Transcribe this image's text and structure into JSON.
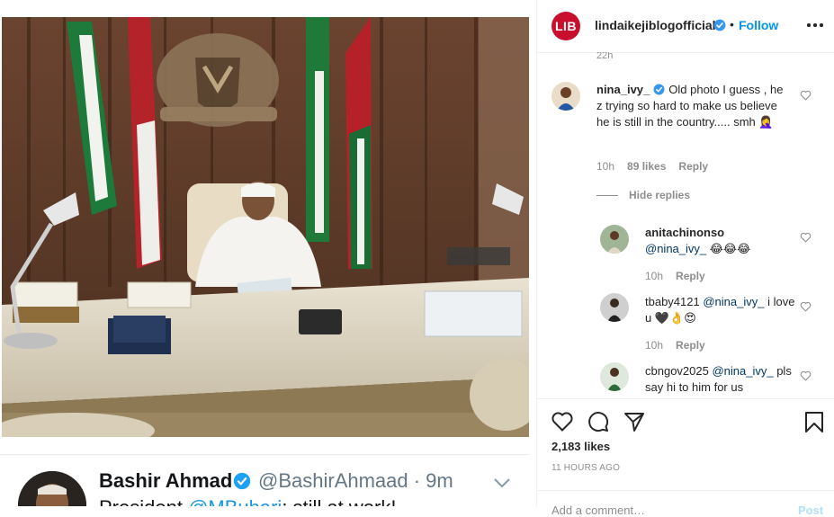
{
  "tweet": {
    "name": "Bashir Ahmad",
    "handle": "@BashirAhmaad · 9m",
    "text_prefix": "President ",
    "text_mention": "@MBuhari",
    "text_suffix": ": still at work!"
  },
  "header": {
    "logo": "LIB",
    "username": "lindaikejiblogofficial",
    "dot": "•",
    "follow": "Follow"
  },
  "comments": {
    "cut_time": "22h",
    "main": {
      "username": "nina_ivy_",
      "text": "Old photo I guess , he z trying so hard to make us believe he is still in the country..... smh 🤦‍♀️",
      "time": "10h",
      "likes": "89 likes",
      "reply": "Reply"
    },
    "hide_replies": "Hide replies",
    "replies": [
      {
        "username": "anitachinonso",
        "mention": "@nina_ivy_",
        "text": " 😂😂😂",
        "time": "10h",
        "reply": "Reply"
      },
      {
        "username": "tbaby4121",
        "mention": "@nina_ivy_",
        "text": " i love u 🖤👌😍",
        "time": "10h",
        "reply": "Reply"
      },
      {
        "username": "cbngov2025",
        "mention": "@nina_ivy_",
        "text": " pls say hi to him for us"
      }
    ]
  },
  "footer": {
    "likes": "2,183 likes",
    "time": "11 HOURS AGO",
    "comment_placeholder": "Add a comment…",
    "post": "Post"
  },
  "colors": {
    "brand_red": "#c8102e",
    "follow_blue": "#0095f6",
    "twitter_blue": "#1b95e0"
  },
  "icons": [
    "verified-badge-icon",
    "more-options-icon",
    "heart-icon",
    "comment-icon",
    "share-icon",
    "bookmark-icon",
    "chevron-down-icon"
  ]
}
